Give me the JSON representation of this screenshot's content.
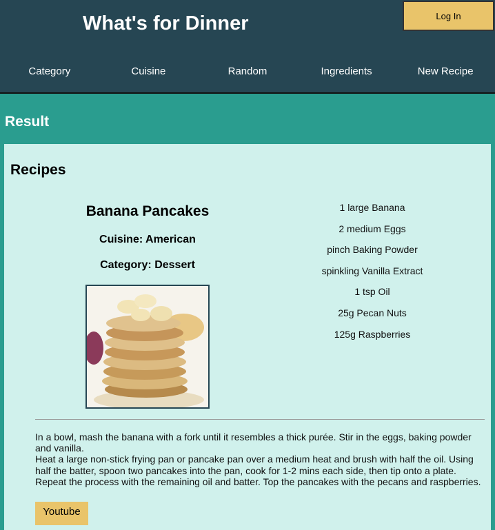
{
  "header": {
    "title": "What's for Dinner",
    "login_label": "Log In",
    "nav": [
      "Category",
      "Cuisine",
      "Random",
      "Ingredients",
      "New Recipe"
    ]
  },
  "result_heading": "Result",
  "recipes_heading": "Recipes",
  "recipe": {
    "title": "Banana Pancakes",
    "cuisine": "Cuisine: American",
    "category": "Category: Dessert",
    "ingredients": [
      "1 large Banana",
      "2 medium Eggs",
      "pinch Baking Powder",
      "spinkling Vanilla Extract",
      "1 tsp Oil",
      "25g Pecan Nuts",
      "125g Raspberries"
    ],
    "instructions": "In a bowl, mash the banana with a fork until it resembles a thick purée. Stir in the eggs, baking powder and vanilla.\nHeat a large non-stick frying pan or pancake pan over a medium heat and brush with half the oil. Using half the batter, spoon two pancakes into the pan, cook for 1-2 mins each side, then tip onto a plate. Repeat the process with the remaining oil and batter. Top the pancakes with the pecans and raspberries.",
    "youtube_label": "Youtube"
  },
  "colors": {
    "header_bg": "#264653",
    "page_bg": "#2a9d8f",
    "panel_bg": "#d0f1ec",
    "button_bg": "#e9c46a"
  }
}
